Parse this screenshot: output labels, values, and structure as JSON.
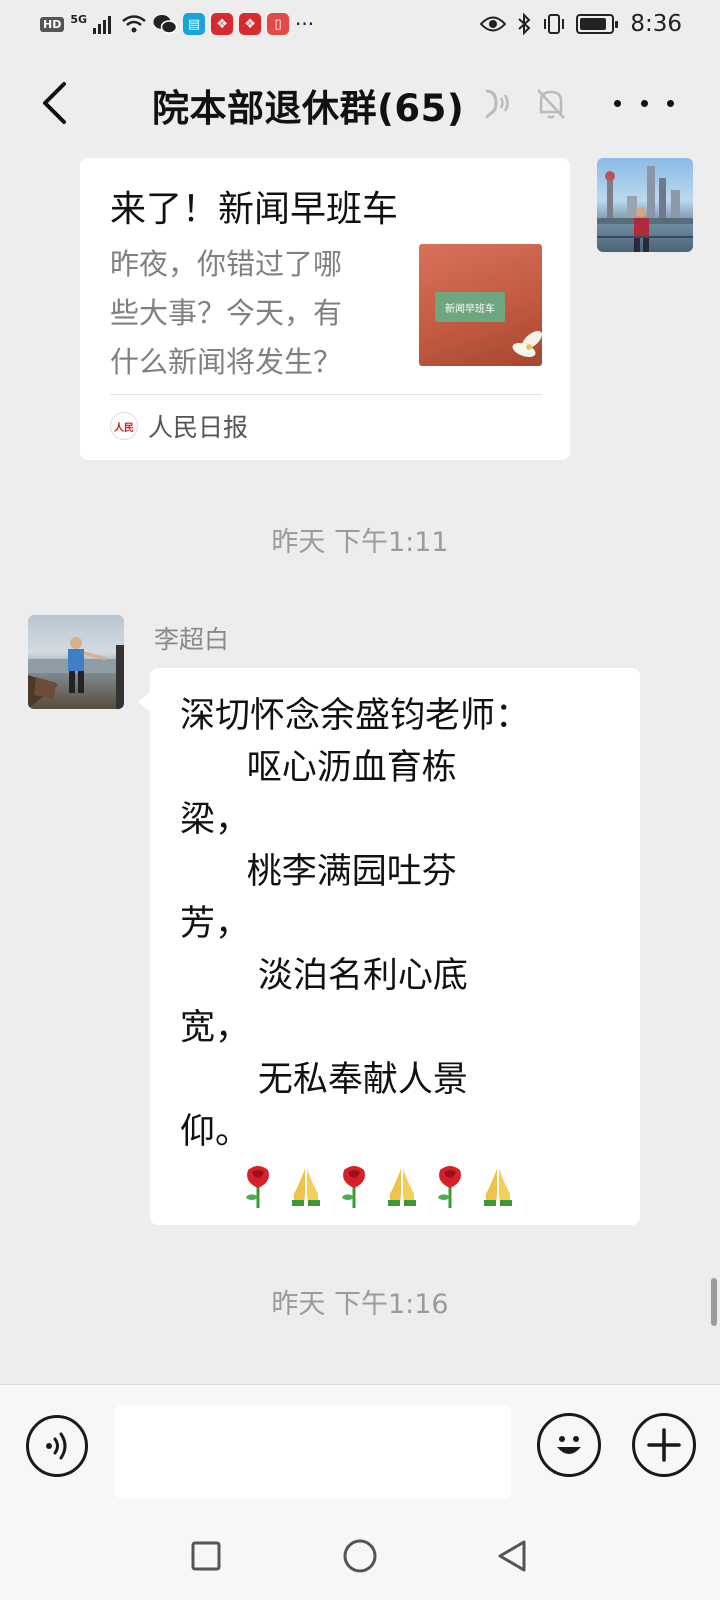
{
  "status_bar": {
    "network_badge": "HD",
    "network_type": "5G",
    "more_indicator": "···",
    "time": "8:36",
    "battery_level": 0.85
  },
  "header": {
    "title": "院本部退休群(65)"
  },
  "article_card": {
    "title": "来了！新闻早班车",
    "description_lines": [
      "昨夜，你错过了哪",
      "些大事？今天，有",
      "什么新闻将发生？"
    ],
    "thumbnail_text": "新闻早班车",
    "source": "人民日报"
  },
  "timestamps": [
    "昨天 下午1:11",
    "昨天 下午1:16"
  ],
  "message": {
    "sender": "李超白",
    "lines": [
      "深切怀念余盛钧老师：",
      "      呕心沥血育栋",
      "梁，",
      "      桃李满园吐芬",
      "芳，",
      "       淡泊名利心底",
      "宽，",
      "       无私奉献人景",
      "仰。"
    ],
    "emojis": [
      "🌹",
      "🙏",
      "🌹",
      "🙏",
      "🌹",
      "🙏"
    ]
  },
  "input": {
    "value": "",
    "placeholder": ""
  },
  "colors": {
    "background": "#ededed",
    "bubble": "#ffffff",
    "accent_red": "#c0231b"
  }
}
